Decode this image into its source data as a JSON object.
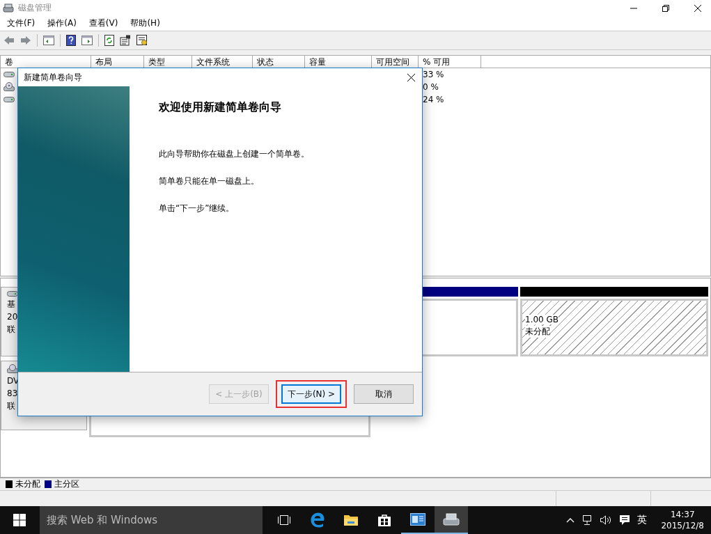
{
  "window": {
    "title": "磁盘管理"
  },
  "menu": [
    {
      "label": "文件(F)"
    },
    {
      "label": "操作(A)"
    },
    {
      "label": "查看(V)"
    },
    {
      "label": "帮助(H)"
    }
  ],
  "toolbar": [
    {
      "kind": "back"
    },
    {
      "kind": "forward"
    },
    {
      "kind": "sep"
    },
    {
      "kind": "console"
    },
    {
      "kind": "sep"
    },
    {
      "kind": "help"
    },
    {
      "kind": "pane"
    },
    {
      "kind": "sep"
    },
    {
      "kind": "refresh"
    },
    {
      "kind": "properties"
    },
    {
      "kind": "settings"
    }
  ],
  "volume_table": {
    "columns": [
      "卷",
      "布局",
      "类型",
      "文件系统",
      "状态",
      "容量",
      "可用空间",
      "% 可用"
    ],
    "rows": [
      {
        "kind": "disk",
        "percent_free": "33 %"
      },
      {
        "kind": "cd",
        "percent_free": "0 %"
      },
      {
        "kind": "disk",
        "percent_free": "24 %"
      }
    ]
  },
  "disks": [
    {
      "kind": "disk",
      "label_lines": [
        "基",
        "20",
        "联"
      ],
      "partitions": [
        {
          "kind": "primary"
        },
        {
          "kind": "unallocated",
          "lines": [
            "1.00 GB",
            "未分配"
          ]
        }
      ]
    },
    {
      "kind": "cd",
      "label_lines": [
        "DV",
        "83",
        "联"
      ],
      "partitions": [
        {
          "kind": "empty"
        }
      ]
    }
  ],
  "legend": [
    {
      "label": "未分配",
      "color": "#000000"
    },
    {
      "label": "主分区",
      "color": "#000080"
    }
  ],
  "dialog": {
    "title": "新建简单卷向导",
    "heading": "欢迎使用新建简单卷向导",
    "paragraphs": [
      "此向导帮助你在磁盘上创建一个简单卷。",
      "简单卷只能在单一磁盘上。",
      "单击“下一步”继续。"
    ],
    "buttons": [
      {
        "label": "< 上一步(B)",
        "disabled": true,
        "focused": false,
        "highlighted": false
      },
      {
        "label": "下一步(N) >",
        "disabled": false,
        "focused": true,
        "highlighted": true
      },
      {
        "label": "取消",
        "disabled": false,
        "focused": false,
        "highlighted": false
      }
    ]
  },
  "taskbar": {
    "search": {
      "placeholder": "搜索 Web 和 Windows"
    },
    "apps": [
      {
        "kind": "task-view",
        "active": false,
        "running": false
      },
      {
        "kind": "edge",
        "active": false,
        "running": false
      },
      {
        "kind": "explorer",
        "active": false,
        "running": false
      },
      {
        "kind": "store",
        "active": false,
        "running": false
      },
      {
        "kind": "app",
        "active": false,
        "running": true
      },
      {
        "kind": "disk",
        "active": true,
        "running": true
      }
    ],
    "tray": {
      "ime": "英",
      "time": "14:37",
      "date": "2015/12/8"
    }
  }
}
